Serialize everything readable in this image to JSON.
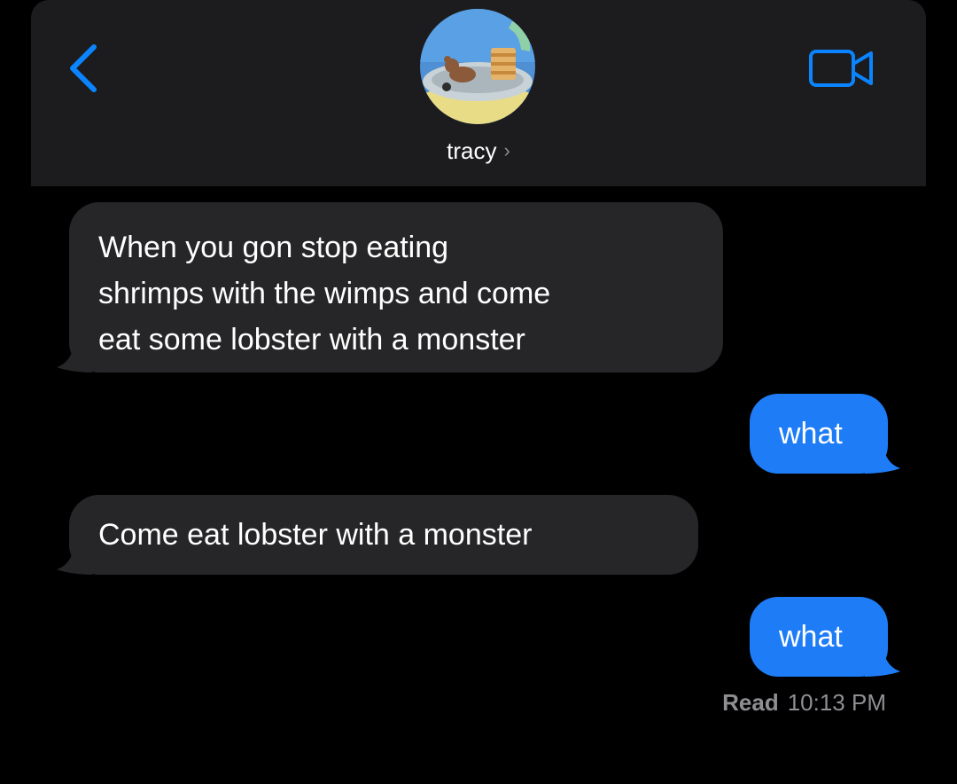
{
  "header": {
    "contact_name": "tracy",
    "chevron": "›",
    "back_icon": "chevron-left-icon",
    "video_icon": "video-camera-icon",
    "accent_color": "#0a84ff"
  },
  "messages": [
    {
      "direction": "incoming",
      "lines": [
        "When you gon stop eating",
        "shrimps with the wimps and come",
        "eat some lobster with a monster"
      ]
    },
    {
      "direction": "outgoing",
      "lines": [
        "what"
      ]
    },
    {
      "direction": "incoming",
      "lines": [
        "Come eat lobster with a monster"
      ]
    },
    {
      "direction": "outgoing",
      "lines": [
        "what"
      ]
    }
  ],
  "receipt": {
    "label": "Read",
    "time": "10:13 PM"
  },
  "colors": {
    "incoming_bubble": "#262628",
    "outgoing_bubble": "#1e7cf7",
    "header_background": "#1c1c1e",
    "background": "#000000"
  }
}
